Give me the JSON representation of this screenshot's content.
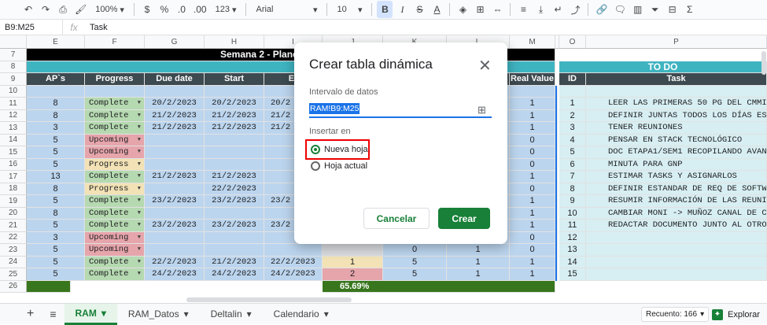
{
  "toolbar": {
    "zoom": "100%",
    "currency": "$",
    "percent": "%",
    "dec_dec": ".0",
    "dec_inc": ".00",
    "number_format": "123",
    "font": "Arial",
    "size": "10",
    "bold": "B",
    "italic": "I",
    "strike": "S",
    "text_color": "A",
    "sigma": "Σ"
  },
  "formula_bar": {
    "name_box": "B9:M25",
    "fx": "fx",
    "value": "Task"
  },
  "columns": [
    "E",
    "F",
    "G",
    "H",
    "I",
    "J",
    "K",
    "L",
    "M",
    "",
    "O",
    "P"
  ],
  "rows": [
    "7",
    "8",
    "9",
    "10",
    "11",
    "12",
    "13",
    "14",
    "15",
    "16",
    "17",
    "18",
    "19",
    "20",
    "21",
    "22",
    "23",
    "24",
    "25",
    "26"
  ],
  "headers": {
    "week_title": "Semana 2 - Planeación y Análisis",
    "todo": "TO DO",
    "aps": "AP`s",
    "progress": "Progress",
    "due_date": "Due date",
    "start": "Start",
    "end_partial": "Er",
    "e_partial": "e",
    "real_value": "Real Value",
    "id": "ID",
    "task": "Task"
  },
  "table": [
    {
      "ap": "8",
      "progress": "Complete",
      "status": "complete",
      "due": "20/2/2023",
      "start": "20/2/2023",
      "end": "20/2",
      "j": "",
      "k": "",
      "l": "",
      "real": "1",
      "id": "1",
      "task": "LEER LAS PRIMERAS 50 PG DEL CMMI"
    },
    {
      "ap": "8",
      "progress": "Complete",
      "status": "complete",
      "due": "21/2/2023",
      "start": "21/2/2023",
      "end": "21/2",
      "j": "",
      "k": "",
      "l": "",
      "real": "1",
      "id": "2",
      "task": "DEFINIR JUNTAS TODOS LOS DÍAS ESTA"
    },
    {
      "ap": "3",
      "progress": "Complete",
      "status": "complete",
      "due": "21/2/2023",
      "start": "21/2/2023",
      "end": "21/2",
      "j": "",
      "k": "",
      "l": "",
      "real": "1",
      "id": "3",
      "task": "TENER REUNIONES"
    },
    {
      "ap": "5",
      "progress": "Upcoming",
      "status": "upcoming",
      "due": "",
      "start": "",
      "end": "",
      "j": "",
      "k": "",
      "l": "",
      "real": "0",
      "id": "4",
      "task": "PENSAR EN STACK TECNOLÓGICO"
    },
    {
      "ap": "5",
      "progress": "Upcoming",
      "status": "upcoming",
      "due": "",
      "start": "",
      "end": "",
      "j": "",
      "k": "",
      "l": "",
      "real": "0",
      "id": "5",
      "task": "DOC ETAPA1/SEM1 RECOPILANDO AVANC"
    },
    {
      "ap": "5",
      "progress": "Progress",
      "status": "progress",
      "due": "",
      "start": "",
      "end": "",
      "j": "",
      "k": "",
      "l": "",
      "real": "0",
      "id": "6",
      "task": "MINUTA PARA GNP"
    },
    {
      "ap": "13",
      "progress": "Complete",
      "status": "complete",
      "due": "21/2/2023",
      "start": "21/2/2023",
      "end": "",
      "j": "",
      "k": "",
      "l": "",
      "real": "1",
      "id": "7",
      "task": "ESTIMAR TASKS Y ASIGNARLOS"
    },
    {
      "ap": "8",
      "progress": "Progress",
      "status": "progress",
      "due": "",
      "start": "22/2/2023",
      "end": "",
      "j": "",
      "k": "",
      "l": "",
      "real": "0",
      "id": "8",
      "task": "DEFINIR ESTANDAR DE REQ DE SOFTWA"
    },
    {
      "ap": "5",
      "progress": "Complete",
      "status": "complete",
      "due": "23/2/2023",
      "start": "23/2/2023",
      "end": "23/2",
      "j": "",
      "k": "",
      "l": "",
      "real": "1",
      "id": "9",
      "task": "RESUMIR INFORMACIÓN DE LAS REUNION"
    },
    {
      "ap": "8",
      "progress": "Complete",
      "status": "complete",
      "due": "",
      "start": "",
      "end": "",
      "j": "",
      "k": "",
      "l": "",
      "real": "1",
      "id": "10",
      "task": "CAMBIAR MONI -> MUÑOZ CANAL DE CO"
    },
    {
      "ap": "5",
      "progress": "Complete",
      "status": "complete",
      "due": "23/2/2023",
      "start": "23/2/2023",
      "end": "23/2",
      "j": "",
      "k": "",
      "l": "",
      "real": "1",
      "id": "11",
      "task": "REDACTAR DOCUMENTO JUNTO AL OTRO EQU"
    },
    {
      "ap": "3",
      "progress": "Upcoming",
      "status": "upcoming",
      "due": "",
      "start": "",
      "end": "",
      "j": "",
      "k": "0",
      "l": "1",
      "real": "0",
      "id": "12",
      "task": ""
    },
    {
      "ap": "5",
      "progress": "Upcoming",
      "status": "upcoming",
      "due": "",
      "start": "",
      "end": "",
      "j": "",
      "k": "0",
      "l": "1",
      "real": "0",
      "id": "13",
      "task": ""
    },
    {
      "ap": "5",
      "progress": "Complete",
      "status": "complete",
      "due": "22/2/2023",
      "start": "21/2/2023",
      "end": "22/2/2023",
      "j": "1",
      "k": "5",
      "l": "1",
      "real": "1",
      "id": "14",
      "task": ""
    },
    {
      "ap": "5",
      "progress": "Complete",
      "status": "complete",
      "due": "24/2/2023",
      "start": "24/2/2023",
      "end": "24/2/2023",
      "j": "2",
      "k": "5",
      "l": "1",
      "real": "1",
      "id": "15",
      "task": ""
    }
  ],
  "footer_row": {
    "percent": "65.69%"
  },
  "dialog": {
    "title": "Crear tabla dinámica",
    "range_label": "Intervalo de datos",
    "range_value": "RAM!B9:M25",
    "insert_label": "Insertar en",
    "option_new": "Nueva hoja",
    "option_current": "Hoja actual",
    "cancel": "Cancelar",
    "create": "Crear"
  },
  "bottom_bar": {
    "add": "+",
    "menu": "≡",
    "tabs": [
      "RAM",
      "RAM_Datos",
      "Deltalin",
      "Calendario"
    ],
    "count": "Recuento: 166",
    "explore": "Explorar"
  },
  "colors": {
    "complete": "#b5d9b0",
    "upcoming": "#e6a5ab",
    "progress": "#f2e2b5",
    "header_dark": "#3d4a50",
    "teal": "#3fb4c1",
    "cell_blue": "#bcd5ee",
    "brand_green": "#188038"
  }
}
